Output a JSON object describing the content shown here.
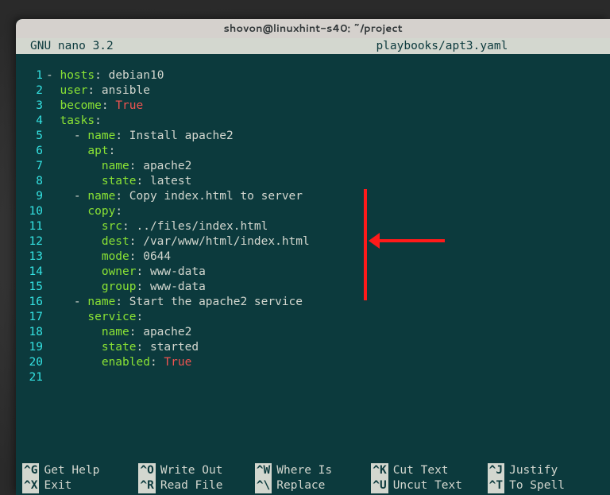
{
  "window": {
    "title": "shovon@linuxhint-s40: ~/project"
  },
  "nano": {
    "version": "GNU nano 3.2",
    "filename": "playbooks/apt3.yaml"
  },
  "lines": [
    {
      "n": "1",
      "t": "- hosts: debian10"
    },
    {
      "n": "2",
      "t": "  user: ansible"
    },
    {
      "n": "3",
      "t": "  become: True"
    },
    {
      "n": "4",
      "t": "  tasks:"
    },
    {
      "n": "5",
      "t": "    - name: Install apache2"
    },
    {
      "n": "6",
      "t": "      apt:"
    },
    {
      "n": "7",
      "t": "        name: apache2"
    },
    {
      "n": "8",
      "t": "        state: latest"
    },
    {
      "n": "9",
      "t": "    - name: Copy index.html to server"
    },
    {
      "n": "10",
      "t": "      copy:"
    },
    {
      "n": "11",
      "t": "        src: ../files/index.html"
    },
    {
      "n": "12",
      "t": "        dest: /var/www/html/index.html"
    },
    {
      "n": "13",
      "t": "        mode: 0644"
    },
    {
      "n": "14",
      "t": "        owner: www-data"
    },
    {
      "n": "15",
      "t": "        group: www-data"
    },
    {
      "n": "16",
      "t": "    - name: Start the apache2 service"
    },
    {
      "n": "17",
      "t": "      service:"
    },
    {
      "n": "18",
      "t": "        name: apache2"
    },
    {
      "n": "19",
      "t": "        state: started"
    },
    {
      "n": "20",
      "t": "        enabled: True"
    },
    {
      "n": "21",
      "t": ""
    }
  ],
  "menu": {
    "row1": [
      {
        "key": "^G",
        "label": "Get Help"
      },
      {
        "key": "^O",
        "label": "Write Out"
      },
      {
        "key": "^W",
        "label": "Where Is"
      },
      {
        "key": "^K",
        "label": "Cut Text"
      },
      {
        "key": "^J",
        "label": "Justify"
      }
    ],
    "row2": [
      {
        "key": "^X",
        "label": "Exit"
      },
      {
        "key": "^R",
        "label": "Read File"
      },
      {
        "key": "^\\",
        "label": "Replace"
      },
      {
        "key": "^U",
        "label": "Uncut Text"
      },
      {
        "key": "^T",
        "label": "To Spell"
      }
    ]
  },
  "annotation": {
    "type": "arrow",
    "color": "#ff0000"
  }
}
